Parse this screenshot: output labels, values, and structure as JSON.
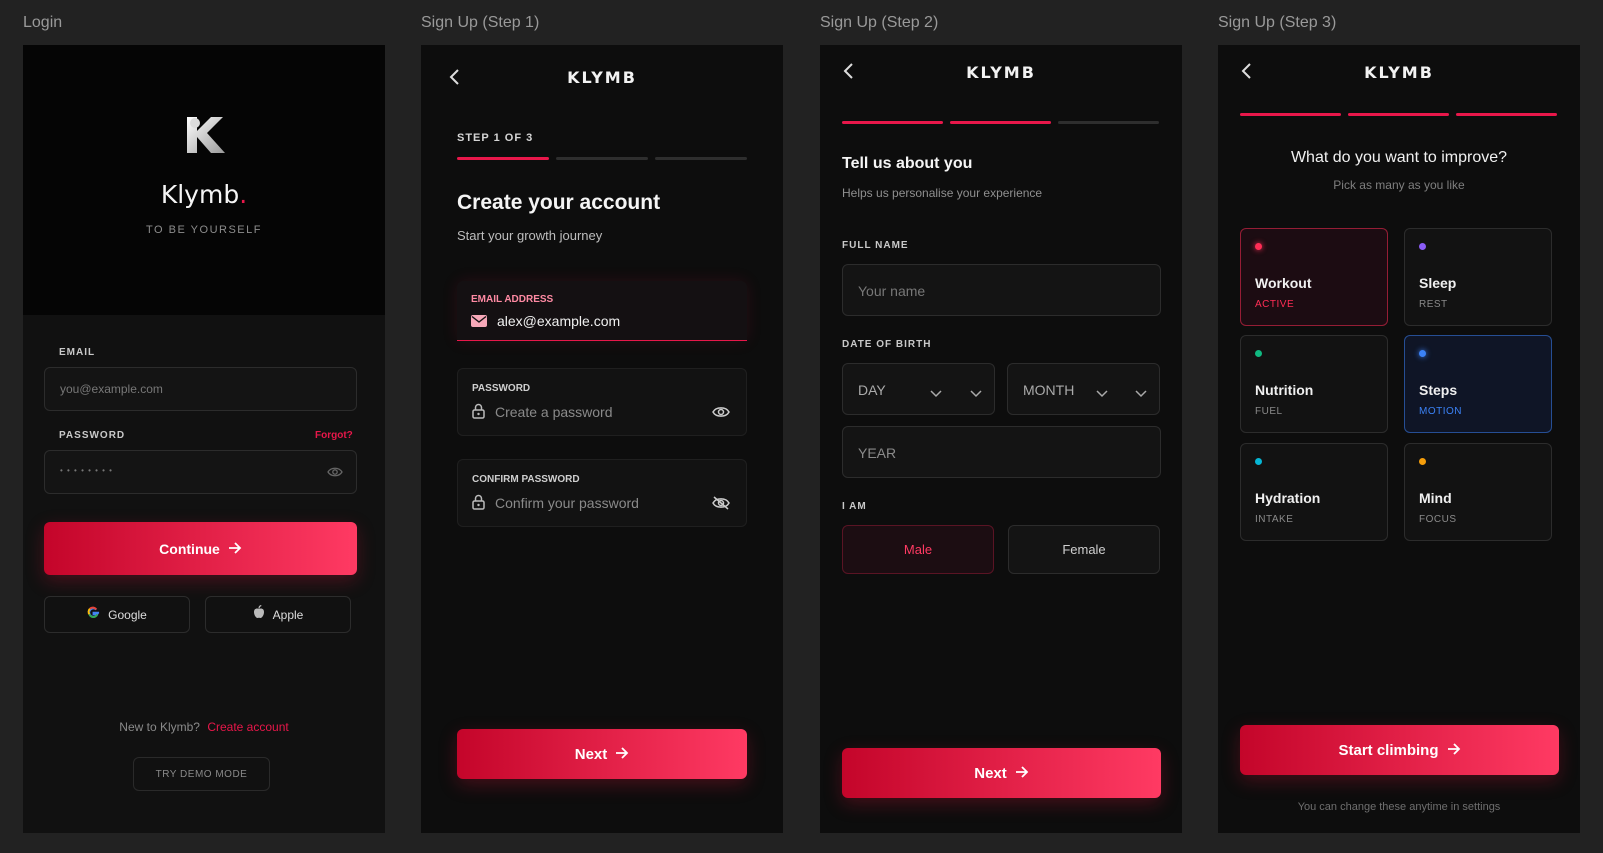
{
  "frames": {
    "login": "Login",
    "step1": "Sign Up (Step 1)",
    "step2": "Sign Up (Step 2)",
    "step3": "Sign Up (Step 3)"
  },
  "colors": {
    "accent": "#e8174a",
    "background": "#0d0d0d",
    "canvas": "#222222"
  },
  "login": {
    "brand_name": "Klymb",
    "brand_dot": ".",
    "tagline": "TO BE YOURSELF",
    "email_label": "EMAIL",
    "email_placeholder": "you@example.com",
    "password_label": "PASSWORD",
    "forgot_label": "Forgot?",
    "password_mask": "• • • • • • • •",
    "continue_label": "Continue",
    "google_label": "Google",
    "apple_label": "Apple",
    "new_prompt": "New to Klymb?",
    "create_account_label": "Create account",
    "demo_label": "TRY DEMO MODE"
  },
  "step1": {
    "brand": "KLYMB",
    "step_label": "STEP 1 OF 3",
    "title": "Create your account",
    "subtitle": "Start your growth journey",
    "email_label": "EMAIL ADDRESS",
    "email_value": "alex@example.com",
    "password_label": "PASSWORD",
    "password_placeholder": "Create a password",
    "confirm_label": "CONFIRM PASSWORD",
    "confirm_placeholder": "Confirm your password",
    "next_label": "Next",
    "progress_filled": 1,
    "progress_total": 3
  },
  "step2": {
    "brand": "KLYMB",
    "title": "Tell us about you",
    "subtitle": "Helps us personalise your experience",
    "fullname_label": "FULL NAME",
    "fullname_placeholder": "Your name",
    "dob_label": "DATE OF BIRTH",
    "day_placeholder": "DAY",
    "month_placeholder": "MONTH",
    "year_placeholder": "YEAR",
    "gender_label": "I AM",
    "male_label": "Male",
    "female_label": "Female",
    "selected_gender": "Male",
    "next_label": "Next",
    "progress_filled": 2,
    "progress_total": 3
  },
  "step3": {
    "brand": "KLYMB",
    "title": "What do you want to improve?",
    "subtitle": "Pick as many as you like",
    "cards": [
      {
        "title": "Workout",
        "sub": "ACTIVE",
        "dot": "#ff2d55",
        "selected": true
      },
      {
        "title": "Sleep",
        "sub": "REST",
        "dot": "#8b5cf6",
        "selected": false
      },
      {
        "title": "Nutrition",
        "sub": "FUEL",
        "dot": "#10b981",
        "selected": false
      },
      {
        "title": "Steps",
        "sub": "MOTION",
        "dot": "#3b82f6",
        "selected": true
      },
      {
        "title": "Hydration",
        "sub": "INTAKE",
        "dot": "#06b6d4",
        "selected": false
      },
      {
        "title": "Mind",
        "sub": "FOCUS",
        "dot": "#f59e0b",
        "selected": false
      }
    ],
    "cta_label": "Start climbing",
    "footnote": "You can change these anytime in settings",
    "progress_filled": 3,
    "progress_total": 3
  }
}
